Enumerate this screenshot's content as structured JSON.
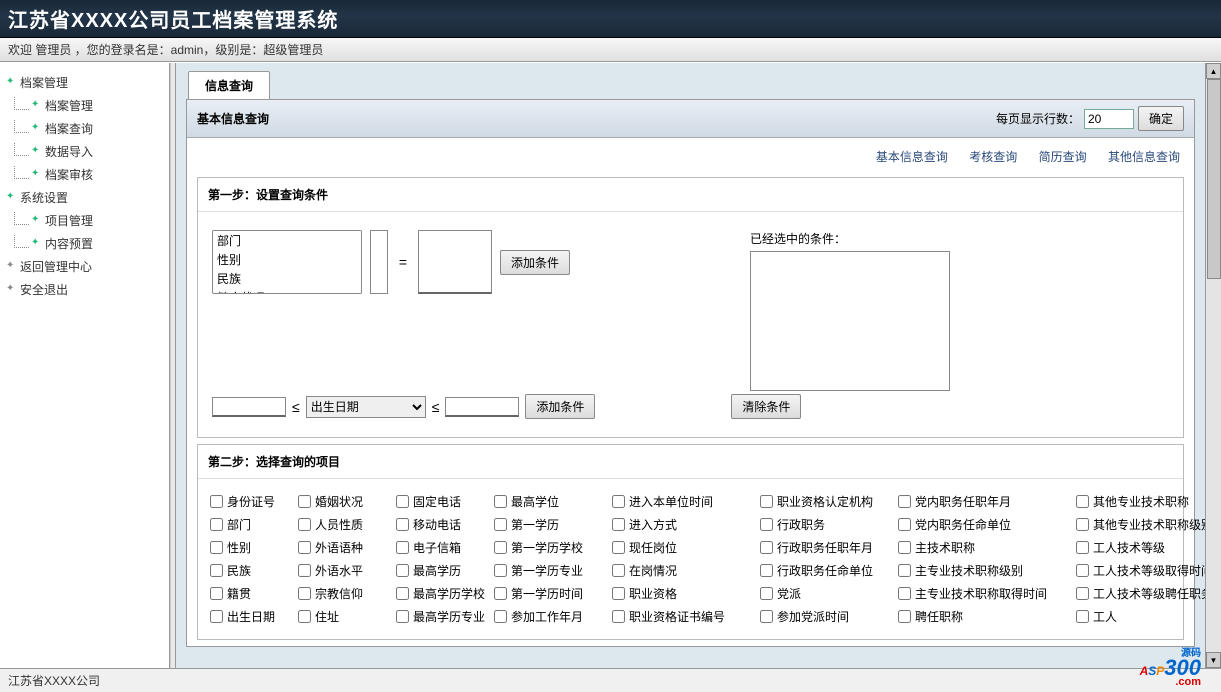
{
  "header": {
    "title": "江苏省XXXX公司员工档案管理系统"
  },
  "subheader": {
    "welcome": "欢迎 管理员 ，您的登录名是：admin，级别是：超级管理员"
  },
  "sidebar": {
    "items": [
      {
        "label": "档案管理",
        "type": "parent"
      },
      {
        "label": "档案管理",
        "type": "child"
      },
      {
        "label": "档案查询",
        "type": "child"
      },
      {
        "label": "数据导入",
        "type": "child"
      },
      {
        "label": "档案审核",
        "type": "child"
      },
      {
        "label": "系统设置",
        "type": "parent"
      },
      {
        "label": "项目管理",
        "type": "child"
      },
      {
        "label": "内容预置",
        "type": "child"
      },
      {
        "label": "返回管理中心",
        "type": "parent-gray"
      },
      {
        "label": "安全退出",
        "type": "parent-gray"
      }
    ]
  },
  "tab": {
    "label": "信息查询"
  },
  "panel": {
    "title": "基本信息查询",
    "rows_label": "每页显示行数：",
    "rows_value": "20",
    "confirm": "确定"
  },
  "links": [
    "基本信息查询",
    "考核查询",
    "简历查询",
    "其他信息查询"
  ],
  "step1": {
    "title": "第一步：设置查询条件",
    "options": [
      "部门",
      "性别",
      "民族",
      "健康状况"
    ],
    "eq": "=",
    "add_btn": "添加条件",
    "selected_label": "已经选中的条件：",
    "le": "≤",
    "date_field": "出生日期",
    "add_btn2": "添加条件",
    "clear_btn": "清除条件"
  },
  "step2": {
    "title": "第二步：选择查询的项目",
    "fields": [
      [
        "身份证号",
        "婚姻状况",
        "固定电话",
        "最高学位",
        "进入本单位时间",
        "职业资格认定机构",
        "党内职务任职年月",
        "其他专业技术职称"
      ],
      [
        "部门",
        "人员性质",
        "移动电话",
        "第一学历",
        "进入方式",
        "行政职务",
        "党内职务任命单位",
        "其他专业技术职称级别"
      ],
      [
        "性别",
        "外语语种",
        "电子信箱",
        "第一学历学校",
        "现任岗位",
        "行政职务任职年月",
        "主技术职称",
        "工人技术等级"
      ],
      [
        "民族",
        "外语水平",
        "最高学历",
        "第一学历专业",
        "在岗情况",
        "行政职务任命单位",
        "主专业技术职称级别",
        "工人技术等级取得时间"
      ],
      [
        "籍贯",
        "宗教信仰",
        "最高学历学校",
        "第一学历时间",
        "职业资格",
        "党派",
        "主专业技术职称取得时间",
        "工人技术等级聘任职务"
      ],
      [
        "出生日期",
        "住址",
        "最高学历专业",
        "参加工作年月",
        "职业资格证书编号",
        "参加党派时间",
        "聘任职称",
        "工人"
      ]
    ]
  },
  "footer": {
    "text": "江苏省XXXX公司"
  }
}
